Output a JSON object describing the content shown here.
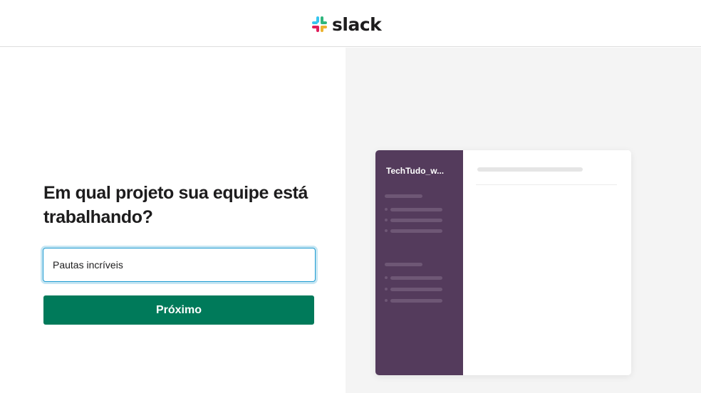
{
  "header": {
    "logo_text": "slack",
    "logo_icon": "slack-hash-icon",
    "logo_colors": [
      "#36c5f0",
      "#2eb67d",
      "#ecb22e",
      "#e01e5a"
    ]
  },
  "form": {
    "heading": "Em qual projeto sua equipe está trabalhando?",
    "input_value": "Pautas incríveis",
    "submit_label": "Próximo"
  },
  "preview": {
    "workspace_name": "TechTudo_w..."
  },
  "colors": {
    "accent_green": "#007a5a",
    "sidebar_purple": "#543b5c",
    "focus_blue": "#1d9bd1"
  }
}
